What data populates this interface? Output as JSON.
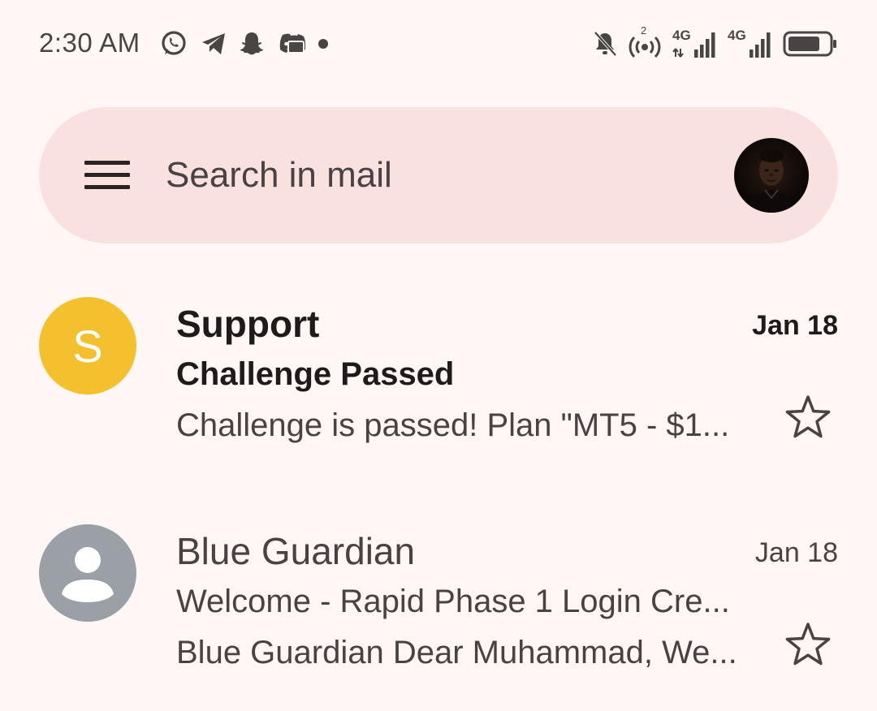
{
  "status_bar": {
    "time": "2:30 AM",
    "app_icons": [
      "whatsapp-icon",
      "telegram-icon",
      "snapchat-icon",
      "discord-icon",
      "dot-icon"
    ],
    "system_icons": [
      "bell-off-icon",
      "hotspot-icon",
      "signal-4g-icon",
      "signal-4g-icon",
      "battery-icon"
    ],
    "network_1": "4G",
    "network_2": "4G",
    "hotspot_count": "2"
  },
  "search": {
    "placeholder": "Search in mail"
  },
  "emails": [
    {
      "sender": "Support",
      "avatar_letter": "S",
      "avatar_color": "#f4c02d",
      "date": "Jan 18",
      "subject": "Challenge Passed",
      "snippet": "Challenge is passed! Plan \"MT5 - $1...",
      "unread": true
    },
    {
      "sender": "Blue Guardian",
      "avatar_color": "#9aa0a6",
      "date": "Jan 18",
      "subject": "Welcome - Rapid Phase 1 Login Cre...",
      "snippet": "Blue Guardian Dear Muhammad, We...",
      "unread": false
    }
  ],
  "colors": {
    "background": "#fff7f5",
    "search_bar": "#f9e1df"
  }
}
